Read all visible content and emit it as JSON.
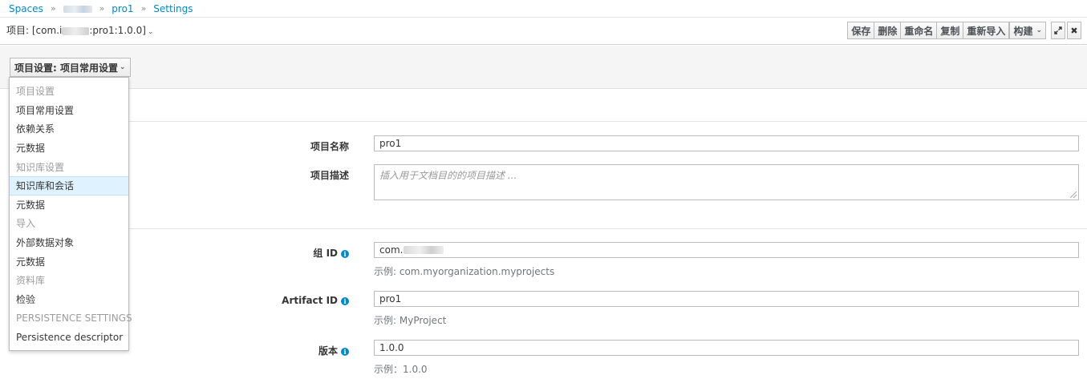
{
  "breadcrumb": {
    "spaces": "Spaces",
    "project": "pro1",
    "settings": "Settings"
  },
  "title": {
    "prefix": "项目: [com.i",
    "suffix": ":pro1:1.0.0]"
  },
  "toolbar": {
    "save": "保存",
    "delete": "删除",
    "rename": "重命名",
    "copy": "复制",
    "reimport": "重新导入",
    "build": "构建"
  },
  "settings_dropdown": {
    "label": "项目设置: 项目常用设置"
  },
  "menu": [
    {
      "label": "项目设置",
      "type": "header"
    },
    {
      "label": "项目常用设置",
      "type": "item"
    },
    {
      "label": "依赖关系",
      "type": "item"
    },
    {
      "label": "元数据",
      "type": "item"
    },
    {
      "label": "知识库设置",
      "type": "header"
    },
    {
      "label": "知识库和会话",
      "type": "item",
      "active": true
    },
    {
      "label": "元数据",
      "type": "item"
    },
    {
      "label": "导入",
      "type": "header"
    },
    {
      "label": "外部数据对象",
      "type": "item"
    },
    {
      "label": "元数据",
      "type": "item"
    },
    {
      "label": "资料库",
      "type": "header"
    },
    {
      "label": "检验",
      "type": "item"
    },
    {
      "label": "PERSISTENCE SETTINGS",
      "type": "header"
    },
    {
      "label": "Persistence descriptor",
      "type": "item"
    }
  ],
  "form": {
    "name_label": "项目名称",
    "name_value": "pro1",
    "desc_label": "项目描述",
    "desc_placeholder": "插入用于文档目的的项目描述 ...",
    "group_label": "组 ID",
    "group_value": "com.",
    "group_hint": "示例: com.myorganization.myprojects",
    "artifact_label": "Artifact ID",
    "artifact_value": "pro1",
    "artifact_hint": "示例: MyProject",
    "version_label": "版本",
    "version_value": "1.0.0",
    "version_hint": "示例：1.0.0"
  },
  "colors": {
    "link": "#0088ce",
    "active_menu_bg": "#def3ff",
    "info_icon": "#0088ce"
  }
}
